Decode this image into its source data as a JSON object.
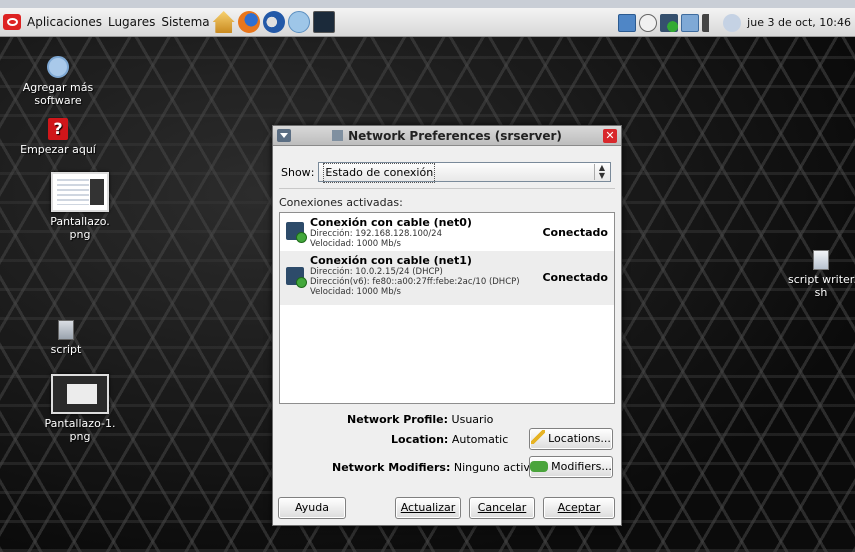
{
  "panel": {
    "menus": [
      "Aplicaciones",
      "Lugares",
      "Sistema"
    ],
    "clock": "jue  3 de oct, 10:46"
  },
  "desktop_icons": [
    {
      "label": "Agregar más",
      "label2": "software",
      "icon": "software-update-icon"
    },
    {
      "label": "Empezar aquí",
      "icon": "help-icon"
    },
    {
      "label": "Pantallazo.",
      "label2": "png",
      "icon": "screenshot-thumbnail-icon"
    },
    {
      "label": "script",
      "icon": "folder-icon"
    },
    {
      "label": "Pantallazo-1.",
      "label2": "png",
      "icon": "screenshot-thumbnail-icon"
    },
    {
      "label": "script writer.",
      "label2": "sh",
      "icon": "script-file-icon"
    }
  ],
  "dialog": {
    "title": "Network Preferences (srserver)",
    "show_label": "Show",
    "show_value": "Estado de conexión",
    "connections_heading": "Conexiones activadas:",
    "connections": [
      {
        "name": "Conexión con cable (net0)",
        "details": [
          "Dirección: 192.168.128.100/24",
          "Velocidad: 1000 Mb/s"
        ],
        "status": "Conectado"
      },
      {
        "name": "Conexión con cable (net1)",
        "details": [
          "Dirección: 10.0.2.15/24 (DHCP)",
          "Dirección(v6): fe80::a00:27ff:febe:2ac/10 (DHCP)",
          "Velocidad: 1000 Mb/s"
        ],
        "status": "Conectado"
      }
    ],
    "profile_label": "Network Profile:",
    "profile_value": "Usuario",
    "location_label": "Location:",
    "location_value": "Automatic",
    "locations_button": "Locations...",
    "modifiers_label": "Network Modifiers:",
    "modifiers_value": "Ninguno activo",
    "modifiers_button": "Modifiers...",
    "buttons": {
      "help": "Ayuda",
      "refresh": "Actualizar",
      "cancel": "Cancelar",
      "ok": "Aceptar"
    }
  }
}
